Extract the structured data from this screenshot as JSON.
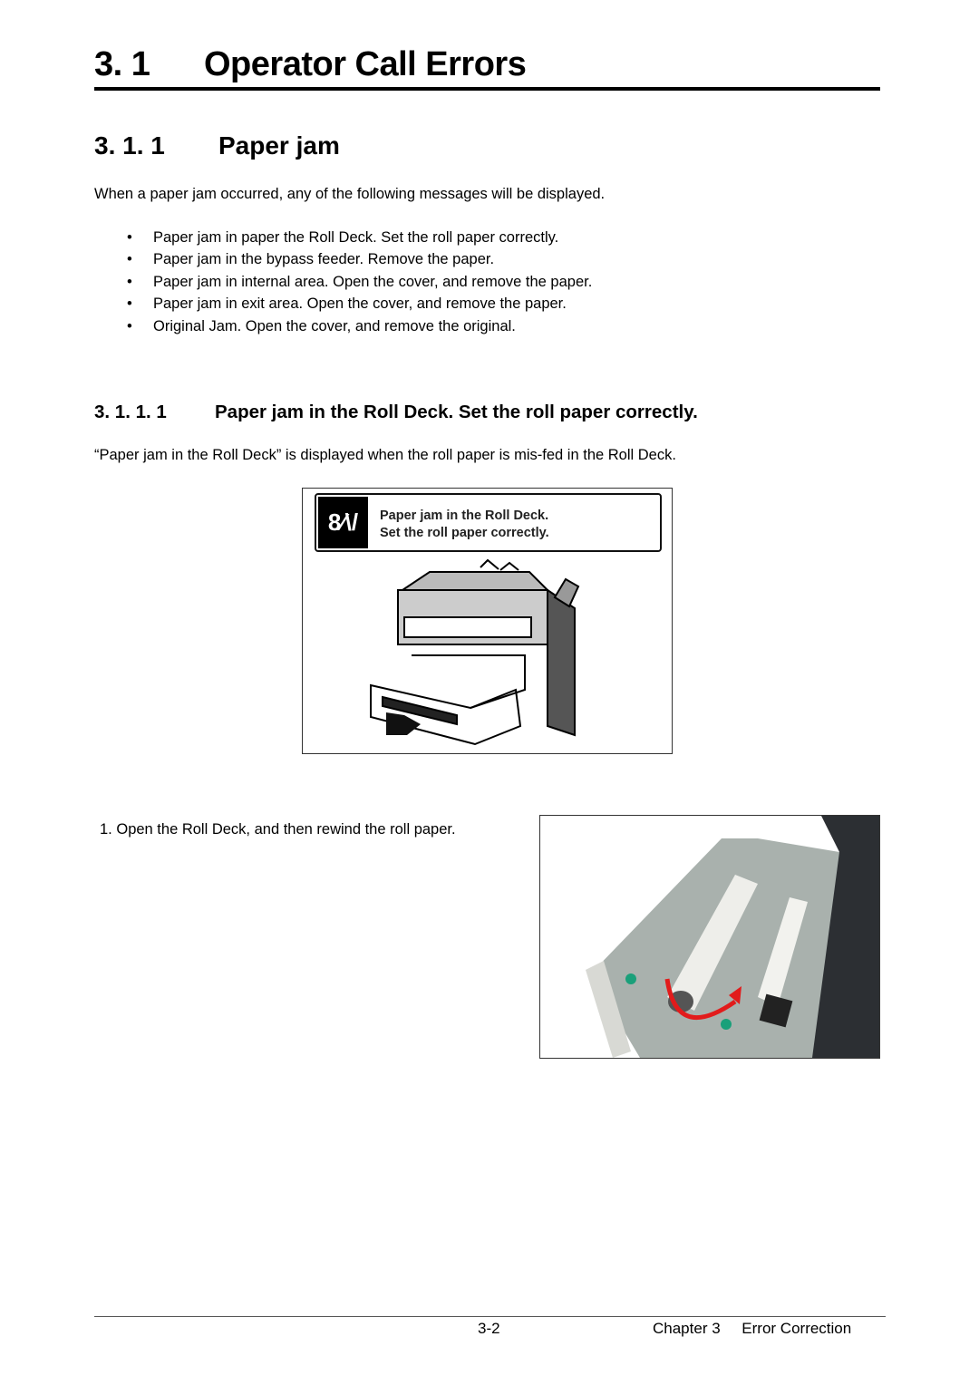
{
  "heading1": {
    "number": "3. 1",
    "title": "Operator Call Errors"
  },
  "heading2": {
    "number": "3. 1. 1",
    "title": "Paper jam"
  },
  "intro": "When a paper jam occurred, any of the following messages will be displayed.",
  "bullet_char": "•",
  "messages": [
    "Paper jam in paper the Roll Deck. Set the roll paper correctly.",
    "Paper jam in the bypass feeder. Remove the paper.",
    "Paper jam in internal area. Open the cover, and remove the paper.",
    "Paper jam in exit area. Open the cover, and remove the paper.",
    "Original Jam. Open the cover, and remove the original."
  ],
  "heading3": {
    "number": "3. 1. 1. 1",
    "title": "Paper jam in the Roll Deck. Set the roll paper correctly."
  },
  "description": "“Paper jam in the Roll Deck” is displayed when the roll paper is mis-fed in the Roll Deck.",
  "figure1": {
    "icon_text": "8⁄\\/",
    "panel_line1": "Paper jam in the Roll Deck.",
    "panel_line2": "Set the roll paper correctly."
  },
  "steps": [
    {
      "number": "1.",
      "text": "Open the Roll Deck, and then rewind the roll paper."
    }
  ],
  "footer": {
    "page": "3-2",
    "chapter": "Chapter 3",
    "section": "Error Correction"
  }
}
